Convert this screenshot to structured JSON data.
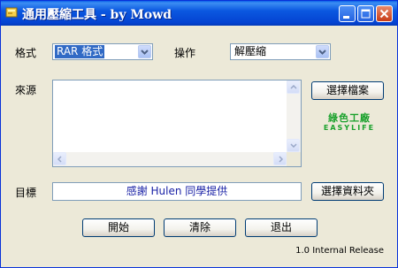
{
  "window": {
    "title": "通用壓縮工具 - by Mowd",
    "titlebar_color": "#0b58e0"
  },
  "format": {
    "label": "格式",
    "selected": "RAR 格式"
  },
  "operation": {
    "label": "操作",
    "selected": "解壓縮"
  },
  "source": {
    "label": "來源",
    "select_file_button": "選擇檔案",
    "text": ""
  },
  "logo": {
    "top": "綠色工廠",
    "bottom": "EASYLIFE",
    "color": "#1aa12c"
  },
  "target": {
    "label": "目標",
    "value": "感謝 Hulen 同學提供",
    "select_folder_button": "選擇資料夾"
  },
  "actions": {
    "start": "開始",
    "clear": "清除",
    "exit": "退出"
  },
  "status": {
    "release": "1.0 Internal Release"
  }
}
